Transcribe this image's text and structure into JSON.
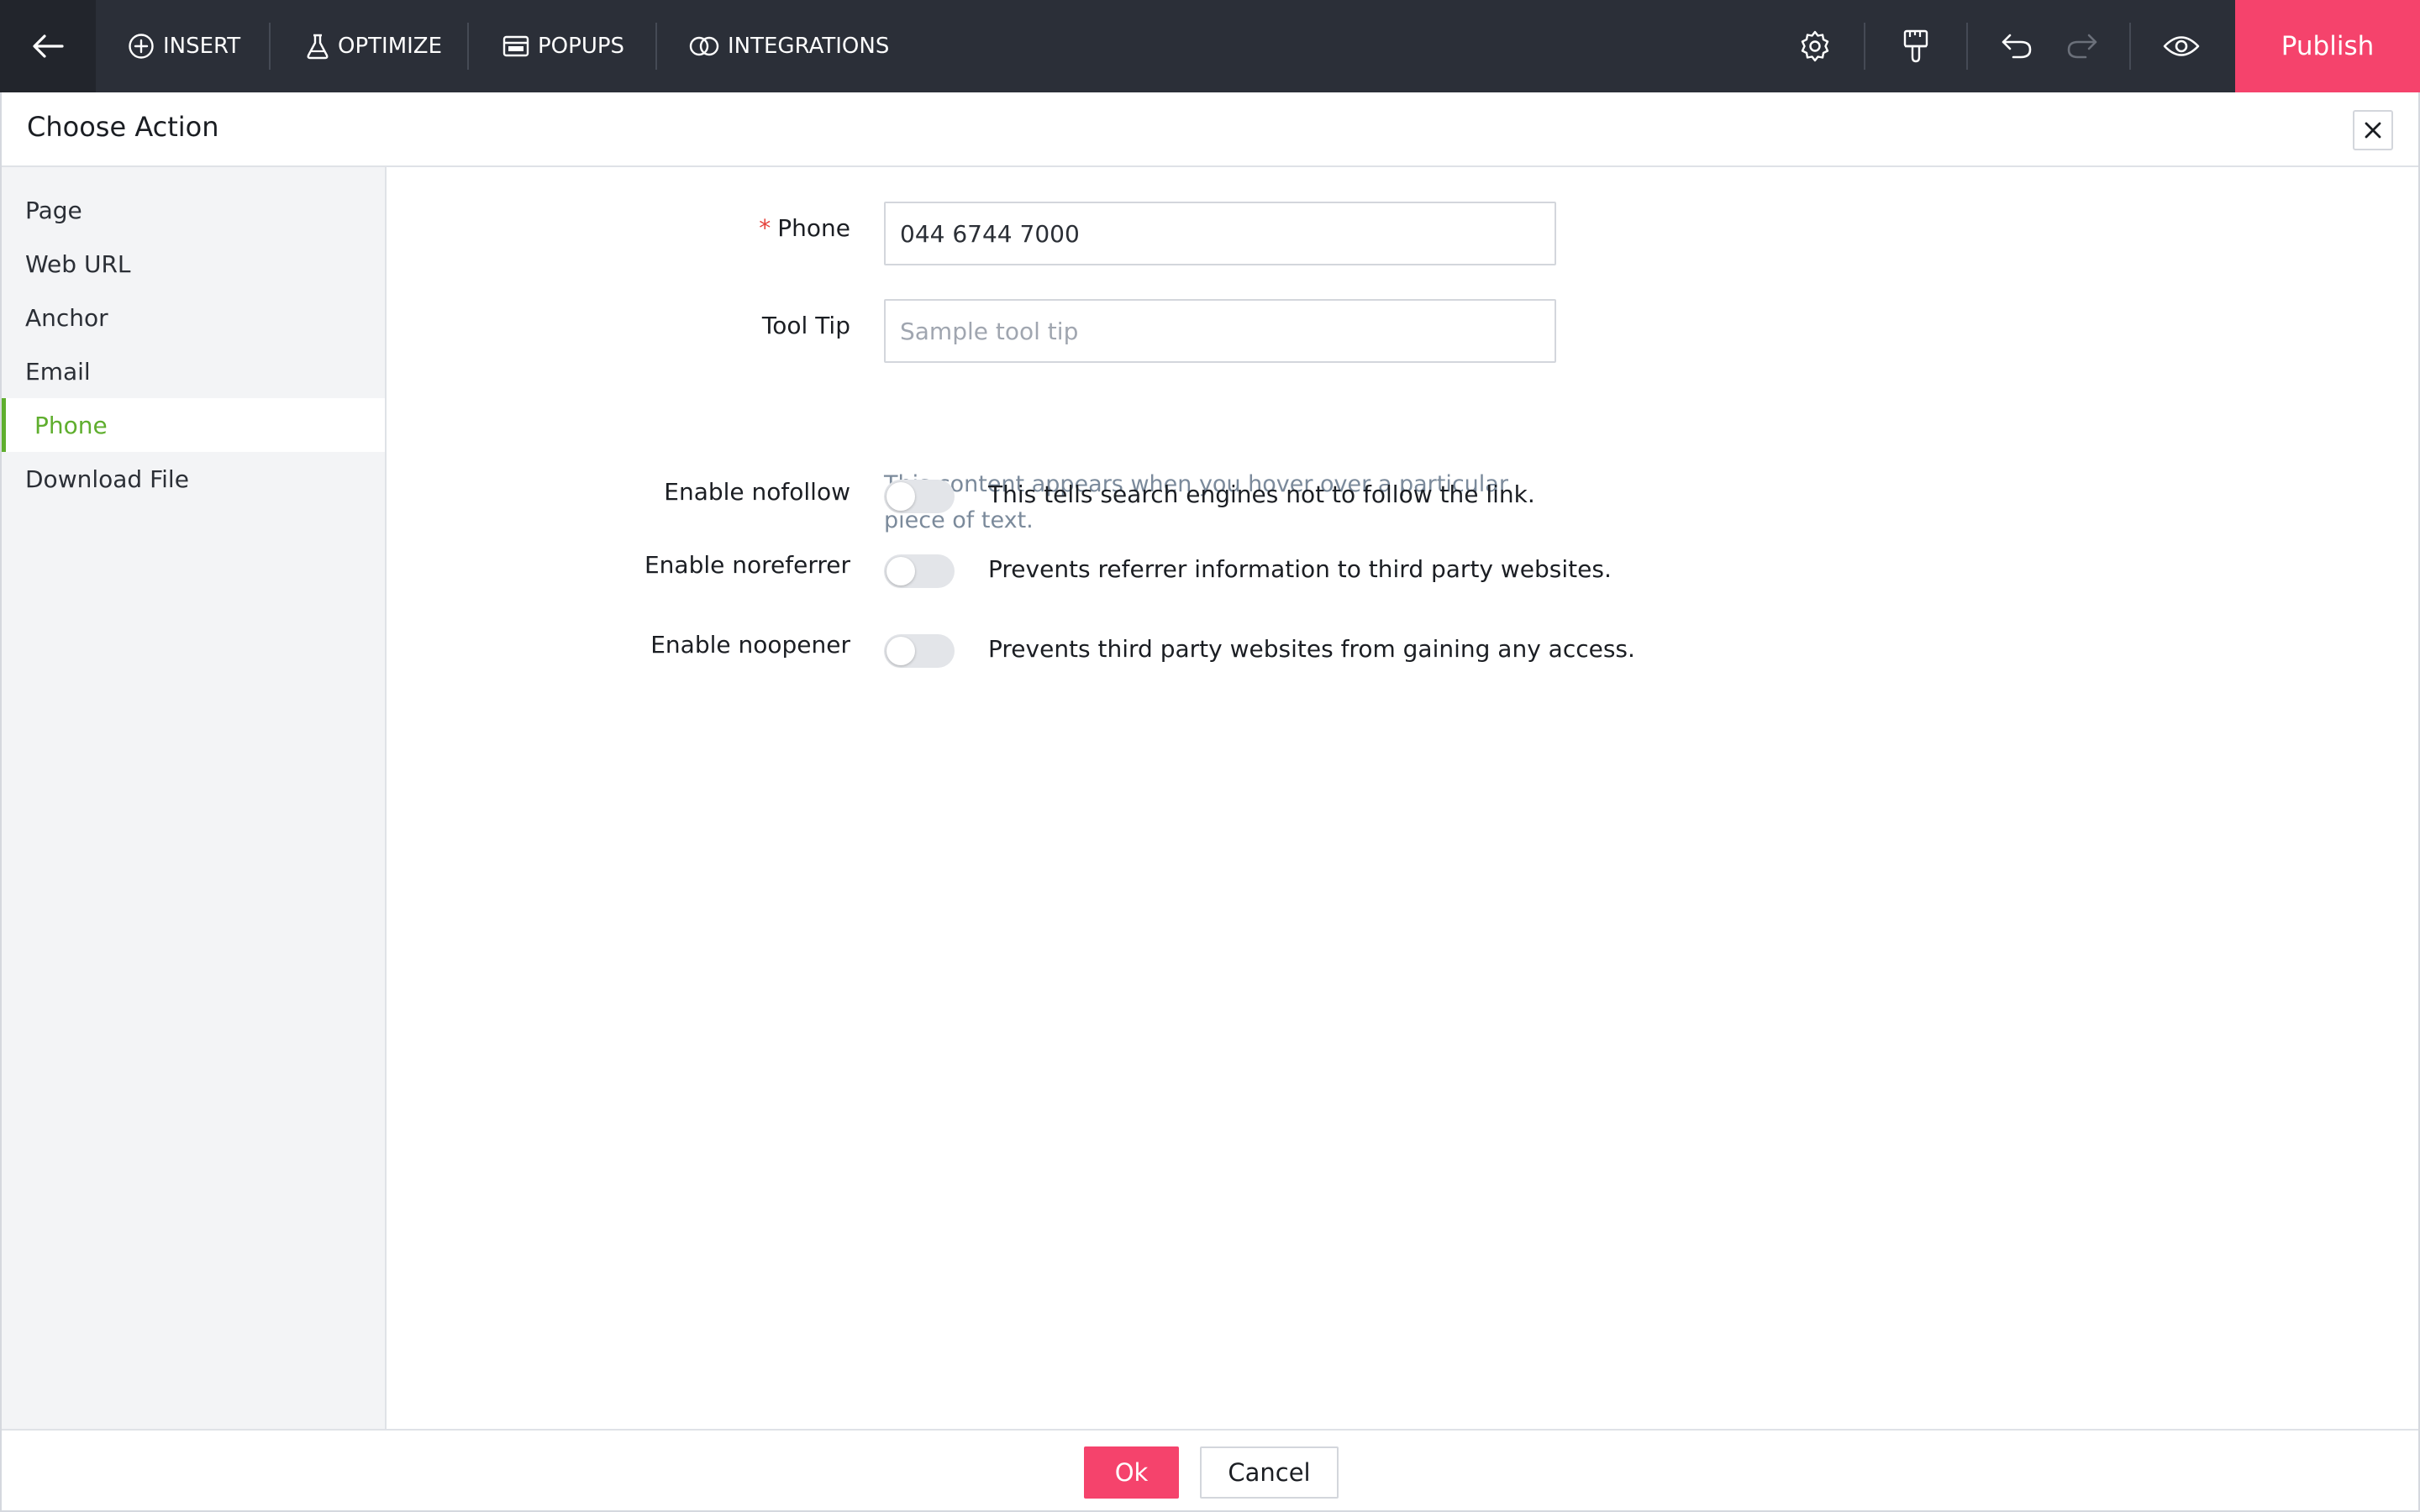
{
  "toolbar": {
    "menu": {
      "insert": "INSERT",
      "optimize": "OPTIMIZE",
      "popups": "POPUPS",
      "integrations": "INTEGRATIONS"
    },
    "publish_label": "Publish",
    "icons": [
      "back-arrow-icon",
      "plus-circle-icon",
      "flask-icon",
      "popup-window-icon",
      "integrations-rings-icon",
      "gear-icon",
      "paint-brush-icon",
      "undo-icon",
      "redo-icon",
      "eye-icon"
    ]
  },
  "dialog": {
    "title": "Choose Action",
    "close_icon": "close-icon"
  },
  "sidebar": {
    "items": [
      {
        "label": "Page"
      },
      {
        "label": "Web URL"
      },
      {
        "label": "Anchor"
      },
      {
        "label": "Email"
      },
      {
        "label": "Phone",
        "active": true
      },
      {
        "label": "Download File"
      }
    ]
  },
  "form": {
    "phone": {
      "required_mark": "*",
      "label": "Phone",
      "value": "044 6744 7000"
    },
    "tooltip": {
      "label": "Tool Tip",
      "placeholder": "Sample tool tip",
      "hint": "This content appears when you hover over a particular piece of text."
    },
    "toggles": [
      {
        "label": "Enable nofollow",
        "description": "This tells search engines not to follow the link.",
        "enabled": false
      },
      {
        "label": "Enable noreferrer",
        "description": "Prevents referrer information to third party websites.",
        "enabled": false
      },
      {
        "label": "Enable noopener",
        "description": "Prevents third party websites from gaining any access.",
        "enabled": false
      }
    ]
  },
  "footer": {
    "ok_label": "Ok",
    "cancel_label": "Cancel"
  },
  "colors": {
    "toolbar_bg": "#2b2f38",
    "accent_pink": "#f5436c",
    "active_green": "#5fae2e",
    "required_red": "#e5413b",
    "hint_text": "#7b8a9b"
  }
}
